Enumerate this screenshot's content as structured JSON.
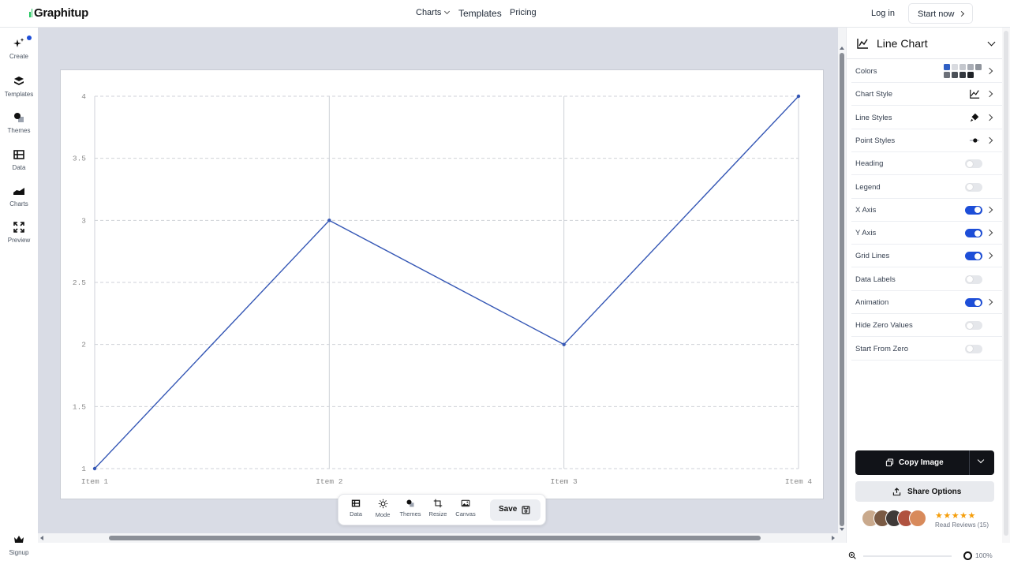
{
  "app": {
    "logo_text": "Graphitup"
  },
  "nav": {
    "charts": "Charts",
    "templates": "Templates",
    "pricing": "Pricing",
    "login": "Log in",
    "start_now": "Start now"
  },
  "leftbar": {
    "items": [
      {
        "label": "Create",
        "icon": "sparkle-icon"
      },
      {
        "label": "Templates",
        "icon": "layers-icon"
      },
      {
        "label": "Themes",
        "icon": "shapes-icon"
      },
      {
        "label": "Data",
        "icon": "table-icon"
      },
      {
        "label": "Charts",
        "icon": "area-chart-icon"
      },
      {
        "label": "Preview",
        "icon": "expand-icon"
      }
    ],
    "signup": "Signup"
  },
  "toolbar": {
    "items": [
      {
        "label": "Data",
        "icon": "table-icon"
      },
      {
        "label": "Mode",
        "icon": "sun-icon"
      },
      {
        "label": "Themes",
        "icon": "shapes-icon"
      },
      {
        "label": "Resize",
        "icon": "crop-icon"
      },
      {
        "label": "Canvas",
        "icon": "image-icon"
      }
    ],
    "save": "Save"
  },
  "panel": {
    "title": "Line Chart",
    "rows": [
      {
        "label": "Colors",
        "control": "swatches",
        "chevron": true
      },
      {
        "label": "Chart Style",
        "control": "line-icon",
        "chevron": true
      },
      {
        "label": "Line Styles",
        "control": "brush-icon",
        "chevron": true
      },
      {
        "label": "Point Styles",
        "control": "point-icon",
        "chevron": true
      },
      {
        "label": "Heading",
        "control": "toggle",
        "on": false,
        "chevron": false
      },
      {
        "label": "Legend",
        "control": "toggle",
        "on": false,
        "chevron": false
      },
      {
        "label": "X Axis",
        "control": "toggle",
        "on": true,
        "chevron": true
      },
      {
        "label": "Y Axis",
        "control": "toggle",
        "on": true,
        "chevron": true
      },
      {
        "label": "Grid Lines",
        "control": "toggle",
        "on": true,
        "chevron": true
      },
      {
        "label": "Data Labels",
        "control": "toggle",
        "on": false,
        "chevron": false
      },
      {
        "label": "Animation",
        "control": "toggle",
        "on": true,
        "chevron": true
      },
      {
        "label": "Hide Zero Values",
        "control": "toggle",
        "on": false,
        "chevron": false
      },
      {
        "label": "Start From Zero",
        "control": "toggle",
        "on": false,
        "chevron": false
      }
    ],
    "swatch_colors": [
      "#2f5fc4",
      "#d9dbe0",
      "#c4c7cd",
      "#a9adb5",
      "#8f949c",
      "#6b7079",
      "#4b5058",
      "#33373e",
      "#1f2227"
    ],
    "copy_image": "Copy Image",
    "share_options": "Share Options",
    "stars": "★★★★★",
    "reviews": "Read Reviews (15)"
  },
  "status": {
    "zoom": "100%"
  },
  "colors": {
    "accent": "#1d4ed8",
    "line": "#3557b5",
    "canvas_bg": "#d9dce5"
  },
  "chart_data": {
    "type": "line",
    "categories": [
      "Item 1",
      "Item 2",
      "Item 3",
      "Item 4"
    ],
    "series": [
      {
        "values": [
          1,
          3,
          2,
          4
        ]
      }
    ],
    "yticks": [
      "1",
      "1.5",
      "2",
      "2.5",
      "3",
      "3.5",
      "4"
    ],
    "ylim": [
      1,
      4
    ],
    "title": "",
    "xlabel": "",
    "ylabel": "",
    "grid": true,
    "legend": false
  }
}
